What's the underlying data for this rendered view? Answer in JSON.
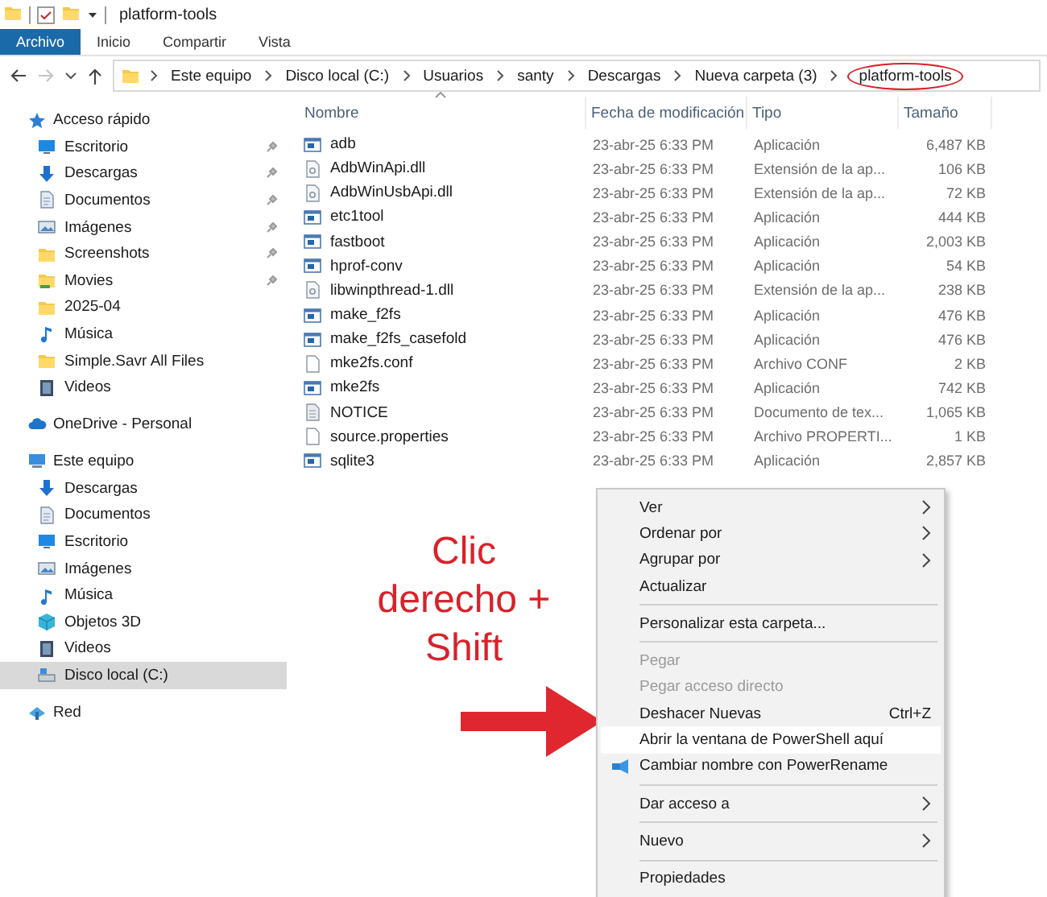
{
  "window": {
    "title": "platform-tools"
  },
  "ribbon_tabs": [
    {
      "label": "Archivo",
      "selected": true
    },
    {
      "label": "Inicio",
      "selected": false
    },
    {
      "label": "Compartir",
      "selected": false
    },
    {
      "label": "Vista",
      "selected": false
    }
  ],
  "address": {
    "crumbs": [
      {
        "label": "Este equipo",
        "circled": false
      },
      {
        "label": "Disco local (C:)",
        "circled": false
      },
      {
        "label": "Usuarios",
        "circled": false
      },
      {
        "label": "santy",
        "circled": false
      },
      {
        "label": "Descargas",
        "circled": false
      },
      {
        "label": "Nueva carpeta (3)",
        "circled": false
      },
      {
        "label": "platform-tools",
        "circled": true
      }
    ]
  },
  "sidebar": {
    "groups": [
      {
        "label": "Acceso rápido",
        "kind": "star",
        "items": [
          {
            "label": "Escritorio",
            "kind": "desktop",
            "pinned": true,
            "selected": false
          },
          {
            "label": "Descargas",
            "kind": "download",
            "pinned": true,
            "selected": false
          },
          {
            "label": "Documentos",
            "kind": "docs",
            "pinned": true,
            "selected": false
          },
          {
            "label": "Imágenes",
            "kind": "images",
            "pinned": true,
            "selected": false
          },
          {
            "label": "Screenshots",
            "kind": "folder",
            "pinned": true,
            "selected": false
          },
          {
            "label": "Movies",
            "kind": "userfolder",
            "pinned": true,
            "selected": false
          },
          {
            "label": "2025-04",
            "kind": "folder",
            "pinned": false,
            "selected": false
          },
          {
            "label": "Música",
            "kind": "music",
            "pinned": false,
            "selected": false
          },
          {
            "label": "Simple.Savr All Files",
            "kind": "folder",
            "pinned": false,
            "selected": false
          },
          {
            "label": "Videos",
            "kind": "video",
            "pinned": false,
            "selected": false
          }
        ]
      },
      {
        "label": "OneDrive - Personal",
        "kind": "cloud"
      },
      {
        "label": "Este equipo",
        "kind": "pc",
        "items": [
          {
            "label": "Descargas",
            "kind": "download",
            "pinned": false,
            "selected": false
          },
          {
            "label": "Documentos",
            "kind": "docs",
            "pinned": false,
            "selected": false
          },
          {
            "label": "Escritorio",
            "kind": "desktop",
            "pinned": false,
            "selected": false
          },
          {
            "label": "Imágenes",
            "kind": "images",
            "pinned": false,
            "selected": false
          },
          {
            "label": "Música",
            "kind": "music",
            "pinned": false,
            "selected": false
          },
          {
            "label": "Objetos 3D",
            "kind": "cube",
            "pinned": false,
            "selected": false
          },
          {
            "label": "Videos",
            "kind": "video",
            "pinned": false,
            "selected": false
          },
          {
            "label": "Disco local (C:)",
            "kind": "drive",
            "pinned": false,
            "selected": true
          }
        ]
      },
      {
        "label": "Red",
        "kind": "network"
      }
    ]
  },
  "table": {
    "columns": [
      "Nombre",
      "Fecha de modificación",
      "Tipo",
      "Tamaño"
    ],
    "rows": [
      {
        "kind": "app",
        "name": "adb",
        "date": "23-abr-25 6:33 PM",
        "type": "Aplicación",
        "size": "6,487 KB"
      },
      {
        "kind": "dll",
        "name": "AdbWinApi.dll",
        "date": "23-abr-25 6:33 PM",
        "type": "Extensión de la ap...",
        "size": "106 KB"
      },
      {
        "kind": "dll",
        "name": "AdbWinUsbApi.dll",
        "date": "23-abr-25 6:33 PM",
        "type": "Extensión de la ap...",
        "size": "72 KB"
      },
      {
        "kind": "app",
        "name": "etc1tool",
        "date": "23-abr-25 6:33 PM",
        "type": "Aplicación",
        "size": "444 KB"
      },
      {
        "kind": "app",
        "name": "fastboot",
        "date": "23-abr-25 6:33 PM",
        "type": "Aplicación",
        "size": "2,003 KB"
      },
      {
        "kind": "app",
        "name": "hprof-conv",
        "date": "23-abr-25 6:33 PM",
        "type": "Aplicación",
        "size": "54 KB"
      },
      {
        "kind": "dll",
        "name": "libwinpthread-1.dll",
        "date": "23-abr-25 6:33 PM",
        "type": "Extensión de la ap...",
        "size": "238 KB"
      },
      {
        "kind": "app",
        "name": "make_f2fs",
        "date": "23-abr-25 6:33 PM",
        "type": "Aplicación",
        "size": "476 KB"
      },
      {
        "kind": "app",
        "name": "make_f2fs_casefold",
        "date": "23-abr-25 6:33 PM",
        "type": "Aplicación",
        "size": "476 KB"
      },
      {
        "kind": "file",
        "name": "mke2fs.conf",
        "date": "23-abr-25 6:33 PM",
        "type": "Archivo CONF",
        "size": "2 KB"
      },
      {
        "kind": "app",
        "name": "mke2fs",
        "date": "23-abr-25 6:33 PM",
        "type": "Aplicación",
        "size": "742 KB"
      },
      {
        "kind": "text",
        "name": "NOTICE",
        "date": "23-abr-25 6:33 PM",
        "type": "Documento de tex...",
        "size": "1,065 KB"
      },
      {
        "kind": "file",
        "name": "source.properties",
        "date": "23-abr-25 6:33 PM",
        "type": "Archivo PROPERTI...",
        "size": "1 KB"
      },
      {
        "kind": "app",
        "name": "sqlite3",
        "date": "23-abr-25 6:33 PM",
        "type": "Aplicación",
        "size": "2,857 KB"
      }
    ]
  },
  "context_menu": {
    "items": [
      {
        "kind": "item",
        "label": "Ver",
        "submenu": true,
        "disabled": false,
        "selected": false
      },
      {
        "kind": "item",
        "label": "Ordenar por",
        "submenu": true,
        "disabled": false,
        "selected": false
      },
      {
        "kind": "item",
        "label": "Agrupar por",
        "submenu": true,
        "disabled": false,
        "selected": false
      },
      {
        "kind": "item",
        "label": "Actualizar",
        "submenu": false,
        "disabled": false,
        "selected": false
      },
      {
        "kind": "separator"
      },
      {
        "kind": "item",
        "label": "Personalizar esta carpeta...",
        "submenu": false,
        "disabled": false,
        "selected": false
      },
      {
        "kind": "separator"
      },
      {
        "kind": "item",
        "label": "Pegar",
        "submenu": false,
        "disabled": true,
        "selected": false
      },
      {
        "kind": "item",
        "label": "Pegar acceso directo",
        "submenu": false,
        "disabled": true,
        "selected": false
      },
      {
        "kind": "item",
        "label": "Deshacer Nuevas",
        "shortcut": "Ctrl+Z",
        "submenu": false,
        "disabled": false,
        "selected": false
      },
      {
        "kind": "item",
        "label": "Abrir la ventana de PowerShell aquí",
        "submenu": false,
        "disabled": false,
        "selected": true
      },
      {
        "kind": "icon_item",
        "label": "Cambiar nombre con PowerRename",
        "submenu": false,
        "disabled": false,
        "selected": false
      },
      {
        "kind": "separator"
      },
      {
        "kind": "item",
        "label": "Dar acceso a",
        "submenu": true,
        "disabled": false,
        "selected": false
      },
      {
        "kind": "separator"
      },
      {
        "kind": "item",
        "label": "Nuevo",
        "submenu": true,
        "disabled": false,
        "selected": false
      },
      {
        "kind": "separator"
      },
      {
        "kind": "item",
        "label": "Propiedades",
        "submenu": false,
        "disabled": false,
        "selected": false
      }
    ]
  },
  "annotation": {
    "lines": [
      "Clic",
      "derecho +",
      "Shift"
    ]
  }
}
